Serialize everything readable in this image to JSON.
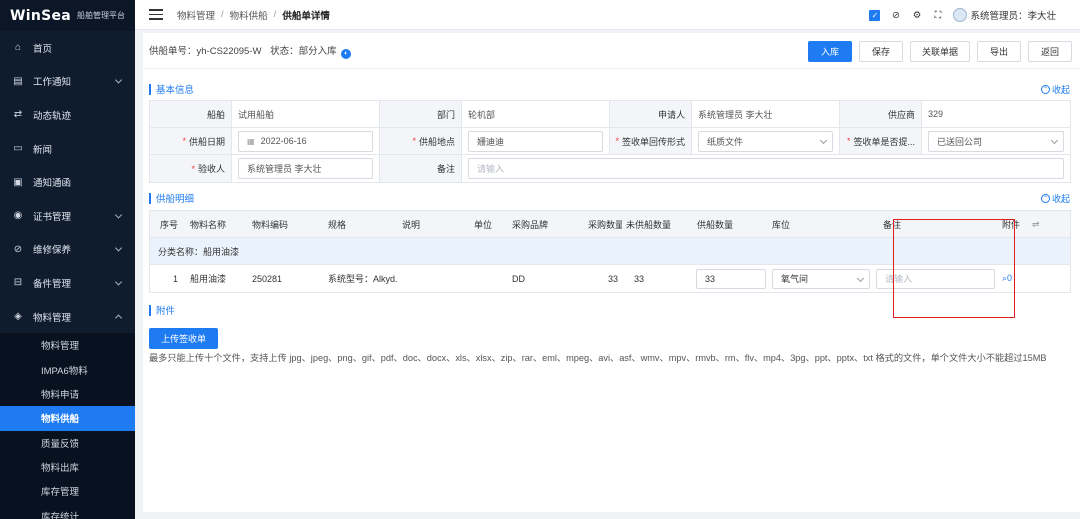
{
  "app": {
    "brand": "WinSea",
    "subtitle": "船舶管理平台"
  },
  "sidebar": {
    "items": [
      {
        "label": "首页",
        "icon": "home-icon",
        "has_children": false
      },
      {
        "label": "工作通知",
        "icon": "message-icon",
        "has_children": true
      },
      {
        "label": "动态轨迹",
        "icon": "route-icon",
        "has_children": false
      },
      {
        "label": "新闻",
        "icon": "news-icon",
        "has_children": false
      },
      {
        "label": "通知通函",
        "icon": "notice-icon",
        "has_children": false
      },
      {
        "label": "证书管理",
        "icon": "certificate-icon",
        "has_children": true
      },
      {
        "label": "维修保养",
        "icon": "maintenance-icon",
        "has_children": true
      },
      {
        "label": "备件管理",
        "icon": "spare-parts-icon",
        "has_children": true
      },
      {
        "label": "物料管理",
        "icon": "material-icon",
        "has_children": true,
        "expanded": true
      }
    ],
    "sub_items": [
      {
        "label": "物料管理",
        "active": false
      },
      {
        "label": "IMPA6物料",
        "active": false
      },
      {
        "label": "物料申请",
        "active": false
      },
      {
        "label": "物料供船",
        "active": true
      },
      {
        "label": "质量反馈",
        "active": false
      },
      {
        "label": "物料出库",
        "active": false
      },
      {
        "label": "库存管理",
        "active": false
      },
      {
        "label": "库存统计",
        "active": false
      }
    ]
  },
  "header": {
    "breadcrumb": [
      "物料管理",
      "物料供船",
      "供船单详情"
    ],
    "user_label": "系统管理员：李大壮"
  },
  "toolbar": {
    "order_no_label": "供船单号：",
    "order_no": "yh-CS22095-W",
    "status_label": "状态：",
    "status": "部分入库",
    "buttons": [
      "入库",
      "保存",
      "关联单据",
      "导出",
      "返回"
    ]
  },
  "basic_info": {
    "title": "基本信息",
    "collapse": "收起",
    "rows": [
      [
        {
          "label": "船舶",
          "value": "试用船舶",
          "required": false,
          "type": "text"
        },
        {
          "label": "部门",
          "value": "轮机部",
          "required": false,
          "type": "text"
        },
        {
          "label": "申请人",
          "value": "系统管理员 李大壮",
          "required": false,
          "type": "text"
        },
        {
          "label": "供应商",
          "value": "329",
          "required": false,
          "type": "text"
        }
      ],
      [
        {
          "label": "供船日期",
          "value": "2022-06-16",
          "required": true,
          "type": "date"
        },
        {
          "label": "供船地点",
          "value": "姗迪迪",
          "required": true,
          "type": "input"
        },
        {
          "label": "签收单回传形式",
          "value": "纸质文件",
          "required": true,
          "type": "select"
        },
        {
          "label": "签收单是否提...",
          "value": "已送回公司",
          "required": true,
          "type": "select"
        }
      ],
      [
        {
          "label": "验收人",
          "value": "系统管理员 李大壮",
          "required": true,
          "type": "input"
        },
        {
          "label": "备注",
          "value": "",
          "placeholder": "请输入",
          "required": false,
          "type": "wide"
        }
      ]
    ]
  },
  "detail": {
    "title": "供船明细",
    "collapse": "收起",
    "columns": [
      "序号",
      "物料名称",
      "物料编码",
      "规格",
      "说明",
      "单位",
      "采购品牌",
      "采购数量",
      "未供船数量",
      "供船数量",
      "库位",
      "备注",
      "附件"
    ],
    "group_label": "分类名称：",
    "group_name": "船用油漆",
    "rows": [
      {
        "no": "1",
        "name": "船用油漆",
        "code": "250281",
        "spec": "系统型号：Alkyd...",
        "desc": "",
        "unit": "",
        "brand": "DD",
        "qty": "33",
        "unsupplied": "33",
        "supply_qty": "33",
        "location": "氧气间",
        "remark_placeholder": "请输入",
        "attachments": "0"
      }
    ]
  },
  "attachments": {
    "title": "附件",
    "upload_button": "上传签收单",
    "note": "最多只能上传十个文件，支持上传 jpg、jpeg、png、gif、pdf、doc、docx、xls、xlsx、zip、rar、eml、mpeg、avi、asf、wmv、mpv、rmvb、rm、flv、mp4、3pg、ppt、pptx、txt 格式的文件，单个文件大小不能超过15MB"
  },
  "colors": {
    "accent": "#1e7bf2",
    "sidebar_bg": "#0f1c2e",
    "highlight": "#e02020"
  }
}
